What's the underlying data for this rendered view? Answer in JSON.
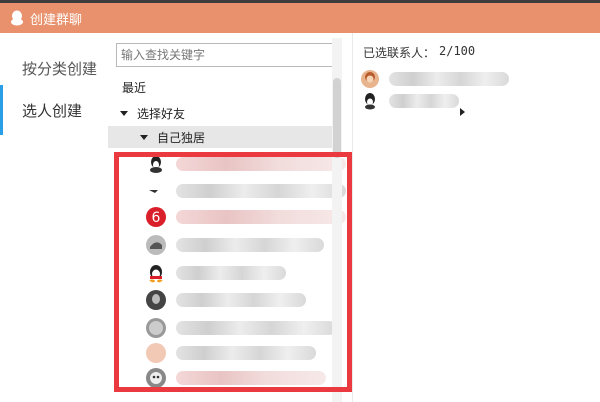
{
  "window": {
    "title": "创建群聊"
  },
  "left_nav": {
    "items": [
      {
        "label": "按分类创建",
        "active": false
      },
      {
        "label": "选人创建",
        "active": true
      }
    ]
  },
  "middle": {
    "search": {
      "placeholder": "输入查找关键字",
      "value": ""
    },
    "tree": {
      "recent": "最近",
      "friends": "选择好友",
      "group": "自己独居"
    },
    "friends_count_visible": 9,
    "badge_number": "6"
  },
  "right": {
    "selected_label": "已选联系人：",
    "selected_count": "2/100"
  },
  "colors": {
    "titlebar": "#e8916c",
    "accent": "#2a9fe6",
    "highlight": "#ea3a3f",
    "badge": "#d9202a"
  }
}
